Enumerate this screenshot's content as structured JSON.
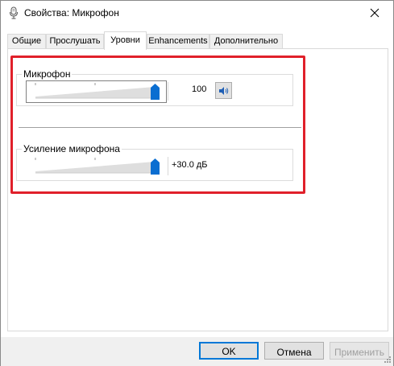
{
  "window": {
    "title": "Свойства: Микрофон",
    "close_glyph": "✕"
  },
  "tabs": [
    {
      "label": "Общие",
      "active": false
    },
    {
      "label": "Прослушать",
      "active": false
    },
    {
      "label": "Уровни",
      "active": true
    },
    {
      "label": "Enhancements",
      "active": false
    },
    {
      "label": "Дополнительно",
      "active": false
    }
  ],
  "levels": {
    "microphone": {
      "label": "Микрофон",
      "value_text": "100",
      "level": 1.0
    },
    "boost": {
      "label": "Усиление микрофона",
      "value_text": "+30.0 дБ",
      "level": 1.0
    }
  },
  "buttons": {
    "ok": "OK",
    "cancel": "Отмена",
    "apply": "Применить"
  },
  "colors": {
    "thumb": "#0a6ed1",
    "highlight": "#e0202a",
    "default_button_border": "#0078d7"
  }
}
